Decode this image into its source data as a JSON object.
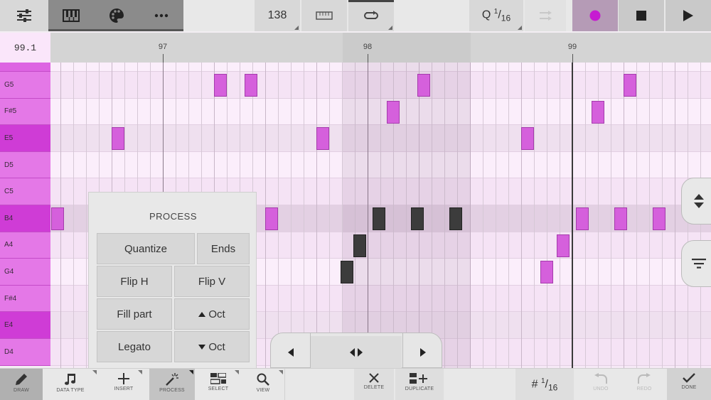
{
  "toolbar": {
    "tempo_bpm": "138",
    "quantize_prefix": "Q",
    "quantize_num": "1",
    "quantize_den": "16"
  },
  "ruler": {
    "position": "99.1",
    "bars": [
      {
        "label": "97",
        "beat": 0
      },
      {
        "label": "98",
        "beat": 4
      },
      {
        "label": "99",
        "beat": 8
      }
    ]
  },
  "keys": [
    {
      "label": "",
      "shade": "top"
    },
    {
      "label": "G5",
      "shade": "light"
    },
    {
      "label": "F#5",
      "shade": "light"
    },
    {
      "label": "E5",
      "shade": "dark"
    },
    {
      "label": "D5",
      "shade": "light"
    },
    {
      "label": "C5",
      "shade": "light"
    },
    {
      "label": "B4",
      "shade": "dark"
    },
    {
      "label": "A4",
      "shade": "light"
    },
    {
      "label": "G4",
      "shade": "light"
    },
    {
      "label": "F#4",
      "shade": "light"
    },
    {
      "label": "E4",
      "shade": "dark"
    },
    {
      "label": "D4",
      "shade": "light"
    }
  ],
  "notes": [
    {
      "row": 1,
      "step": 12.7,
      "selected": false
    },
    {
      "row": 1,
      "step": 15.1,
      "selected": false
    },
    {
      "row": 1,
      "step": 28.6,
      "selected": false
    },
    {
      "row": 1,
      "step": 44.7,
      "selected": false
    },
    {
      "row": 2,
      "step": 26.2,
      "selected": false
    },
    {
      "row": 2,
      "step": 42.2,
      "selected": false
    },
    {
      "row": 3,
      "step": 4.7,
      "selected": false
    },
    {
      "row": 3,
      "step": 20.7,
      "selected": false
    },
    {
      "row": 3,
      "step": 36.7,
      "selected": false
    },
    {
      "row": 6,
      "step": 0,
      "selected": false
    },
    {
      "row": 6,
      "step": 16.7,
      "selected": false
    },
    {
      "row": 6,
      "step": 25.1,
      "selected": true
    },
    {
      "row": 6,
      "step": 28.1,
      "selected": true
    },
    {
      "row": 6,
      "step": 31.1,
      "selected": true
    },
    {
      "row": 6,
      "step": 41.0,
      "selected": false
    },
    {
      "row": 6,
      "step": 44.0,
      "selected": false
    },
    {
      "row": 6,
      "step": 47.0,
      "selected": false
    },
    {
      "row": 7,
      "step": 23.6,
      "selected": true
    },
    {
      "row": 7,
      "step": 39.5,
      "selected": false
    },
    {
      "row": 8,
      "step": 22.6,
      "selected": true
    },
    {
      "row": 8,
      "step": 38.2,
      "selected": false
    }
  ],
  "process": {
    "title": "PROCESS",
    "quantize": "Quantize",
    "ends": "Ends",
    "flip_h": "Flip H",
    "flip_v": "Flip V",
    "fill_part": "Fill part",
    "oct_up": "Oct",
    "legato": "Legato",
    "oct_down": "Oct"
  },
  "bottombar": {
    "draw": "DRAW",
    "datatype": "DATA TYPE",
    "insert": "INSERT",
    "process": "PROCESS",
    "select": "SELECT",
    "view": "VIEW",
    "delete": "DELETE",
    "duplicate": "DUPLICATE",
    "grid_num": "1",
    "grid_den": "16",
    "undo": "UNDO",
    "redo": "REDO",
    "done": "DONE"
  },
  "colors": {
    "accent": "#c61bd1",
    "note": "#d560dc",
    "note_selected": "#3c3c3c"
  }
}
